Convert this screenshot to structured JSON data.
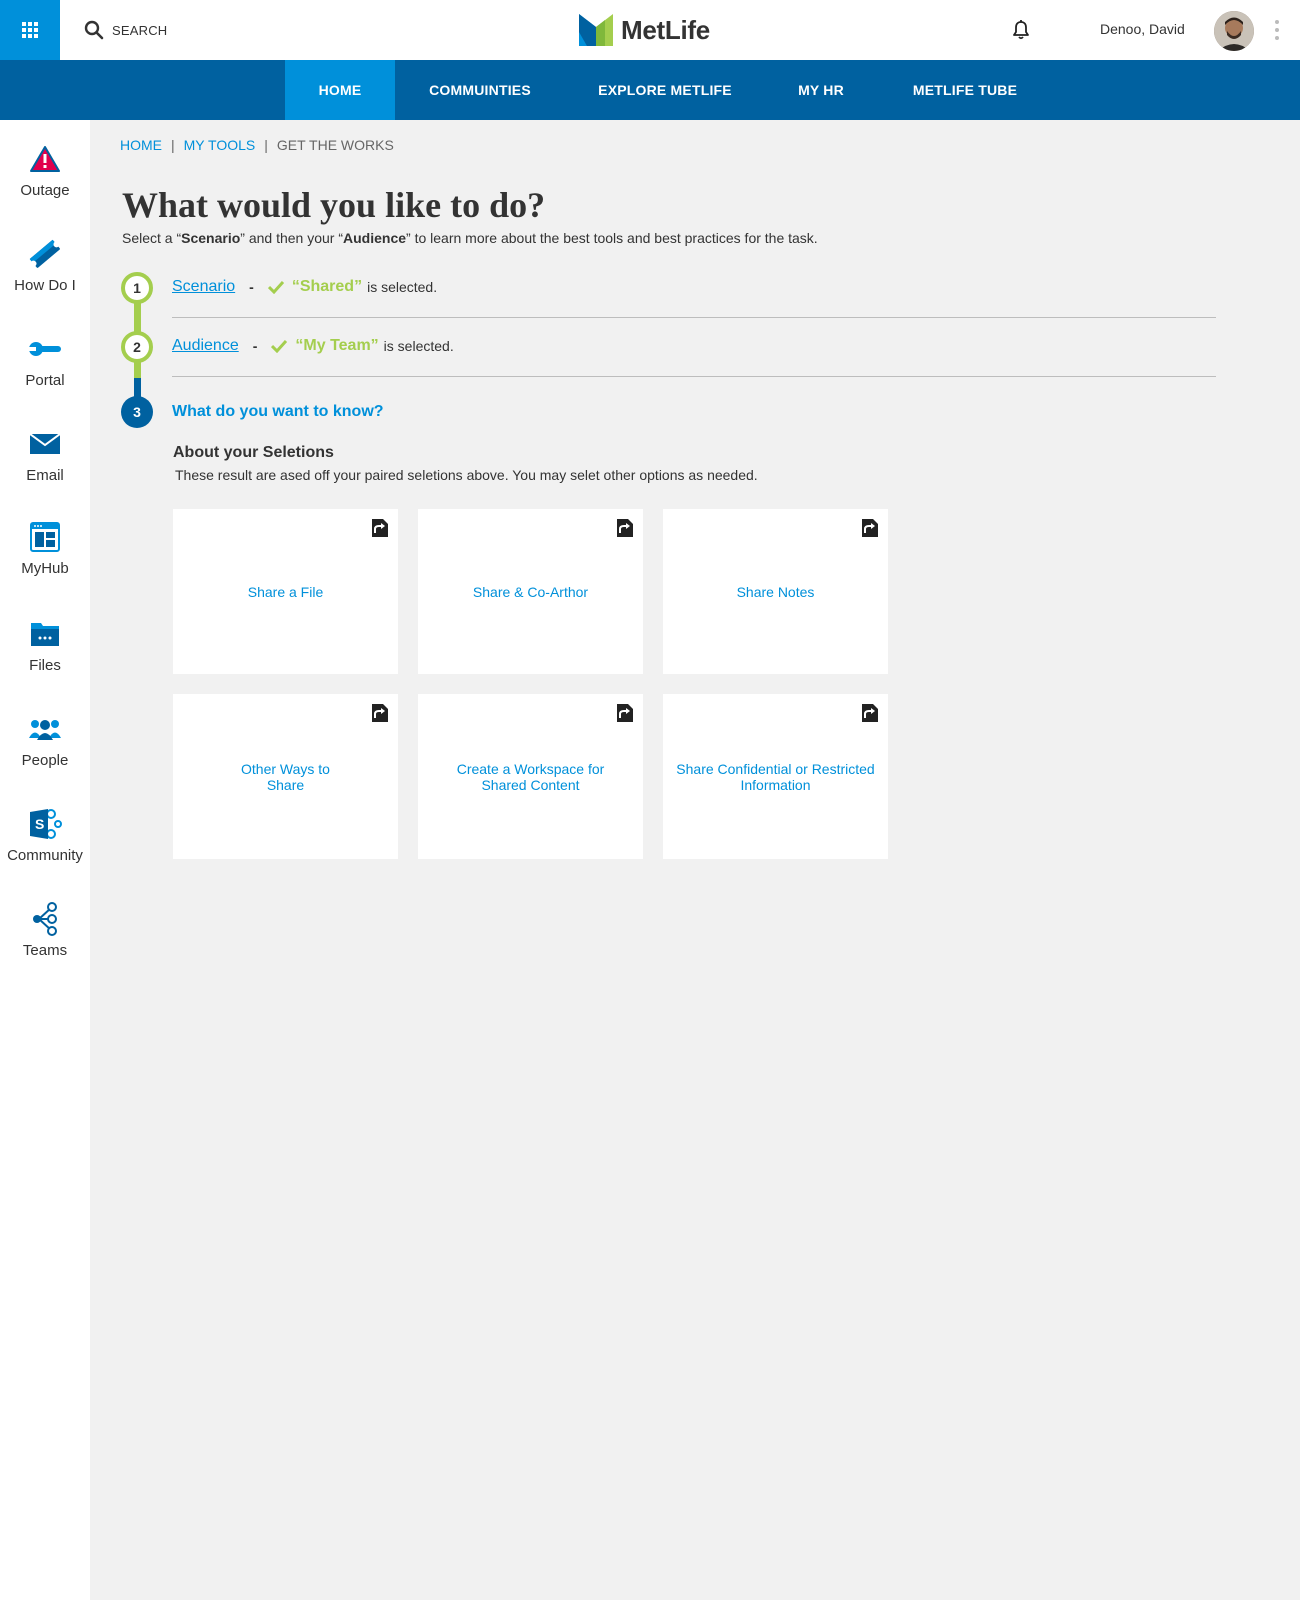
{
  "header": {
    "search_label": "SEARCH",
    "logo_text": "MetLife",
    "user_name": "Denoo, David"
  },
  "nav": {
    "items": [
      {
        "label": "HOME",
        "active": true
      },
      {
        "label": "COMMUINTIES",
        "active": false
      },
      {
        "label": "EXPLORE METLIFE",
        "active": false
      },
      {
        "label": "MY HR",
        "active": false
      },
      {
        "label": "METLIFE TUBE",
        "active": false
      }
    ]
  },
  "sidebar": {
    "items": [
      {
        "label": "Outage",
        "icon": "warning-icon"
      },
      {
        "label": "How Do I",
        "icon": "ticket-icon"
      },
      {
        "label": "Portal",
        "icon": "wrench-icon"
      },
      {
        "label": "Email",
        "icon": "mail-icon"
      },
      {
        "label": "MyHub",
        "icon": "dashboard-icon"
      },
      {
        "label": "Files",
        "icon": "folder-icon"
      },
      {
        "label": "People",
        "icon": "people-icon"
      },
      {
        "label": "Community",
        "icon": "sharepoint-icon"
      },
      {
        "label": "Teams",
        "icon": "teams-icon"
      }
    ]
  },
  "breadcrumb": {
    "items": [
      "HOME",
      "MY TOOLS",
      "GET THE WORKS"
    ],
    "separator": "|"
  },
  "page": {
    "title": "What would you like to do?",
    "intro": {
      "p1": "Select a “",
      "scenario": "Scenario",
      "p2": "” and then your “",
      "audience": "Audience",
      "p3": "” to learn more about the best tools and best practices for the task."
    }
  },
  "steps": [
    {
      "number": "1",
      "label": "Scenario",
      "dash": "-",
      "selected": "“Shared”",
      "suffix": "is selected."
    },
    {
      "number": "2",
      "label": "Audience",
      "dash": "-",
      "selected": "“My Team”",
      "suffix": "is selected."
    },
    {
      "number": "3",
      "label": "What do you want to know?"
    }
  ],
  "about": {
    "title": "About your Seletions",
    "text": "These result are ased off your paired seletions above. You may selet other options as needed."
  },
  "cards": [
    {
      "label": "Share a File"
    },
    {
      "label": "Share & Co-Arthor"
    },
    {
      "label": "Share Notes"
    },
    {
      "label": "Other Ways to Share"
    },
    {
      "label": "Create a Workspace for Shared Content"
    },
    {
      "label": "Share Confidential or Restricted Information"
    }
  ],
  "colors": {
    "brand_blue": "#0061a0",
    "accent_blue": "#0090da",
    "accent_green": "#a4ce4e",
    "background": "#f1f1f1"
  }
}
